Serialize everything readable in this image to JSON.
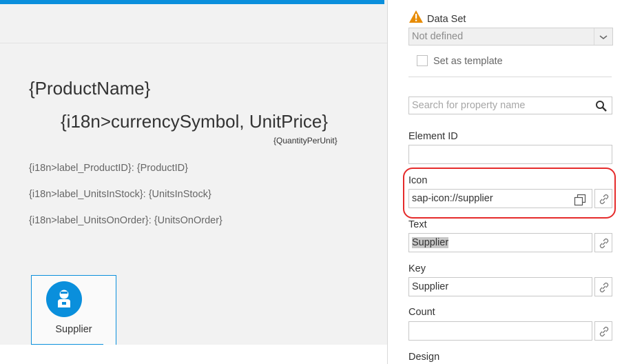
{
  "canvas": {
    "product_name": "{ProductName}",
    "unit_price": "{i18n>currencySymbol, UnitPrice}",
    "quantity_per_unit": "{QuantityPerUnit}",
    "attributes": [
      "{i18n>label_ProductID}: {ProductID}",
      "{i18n>label_UnitsInStock}: {UnitsInStock}",
      "{i18n>label_UnitsOnOrder}: {UnitsOnOrder}"
    ],
    "tile": {
      "label": "Supplier",
      "icon": "supplier-icon"
    }
  },
  "panel": {
    "data_set": {
      "label": "Data Set",
      "icon": "warning-icon",
      "value": "Not defined"
    },
    "template_checkbox": {
      "label": "Set as template",
      "checked": false
    },
    "search": {
      "placeholder": "Search for property name",
      "value": ""
    },
    "element_id": {
      "label": "Element ID",
      "value": ""
    },
    "icon_field": {
      "label": "Icon",
      "value": "sap-icon://supplier"
    },
    "text_field": {
      "label": "Text",
      "value": "Supplier"
    },
    "key_field": {
      "label": "Key",
      "value": "Supplier"
    },
    "count_field": {
      "label": "Count",
      "value": ""
    },
    "design_label": "Design"
  },
  "colors": {
    "accent": "#0a8fdc",
    "warning": "#e78c07",
    "highlight": "#e52a2a"
  }
}
